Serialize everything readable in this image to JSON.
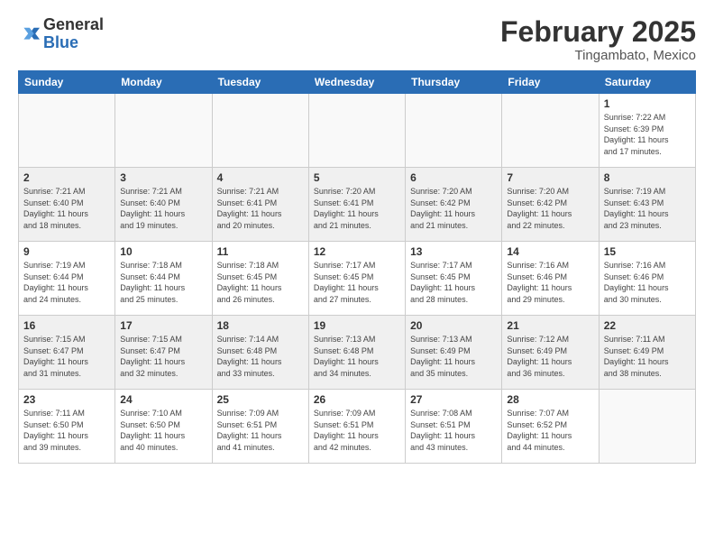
{
  "header": {
    "logo_general": "General",
    "logo_blue": "Blue",
    "month_title": "February 2025",
    "location": "Tingambato, Mexico"
  },
  "calendar": {
    "weekdays": [
      "Sunday",
      "Monday",
      "Tuesday",
      "Wednesday",
      "Thursday",
      "Friday",
      "Saturday"
    ],
    "weeks": [
      [
        {
          "day": "",
          "info": ""
        },
        {
          "day": "",
          "info": ""
        },
        {
          "day": "",
          "info": ""
        },
        {
          "day": "",
          "info": ""
        },
        {
          "day": "",
          "info": ""
        },
        {
          "day": "",
          "info": ""
        },
        {
          "day": "1",
          "info": "Sunrise: 7:22 AM\nSunset: 6:39 PM\nDaylight: 11 hours\nand 17 minutes."
        }
      ],
      [
        {
          "day": "2",
          "info": "Sunrise: 7:21 AM\nSunset: 6:40 PM\nDaylight: 11 hours\nand 18 minutes."
        },
        {
          "day": "3",
          "info": "Sunrise: 7:21 AM\nSunset: 6:40 PM\nDaylight: 11 hours\nand 19 minutes."
        },
        {
          "day": "4",
          "info": "Sunrise: 7:21 AM\nSunset: 6:41 PM\nDaylight: 11 hours\nand 20 minutes."
        },
        {
          "day": "5",
          "info": "Sunrise: 7:20 AM\nSunset: 6:41 PM\nDaylight: 11 hours\nand 21 minutes."
        },
        {
          "day": "6",
          "info": "Sunrise: 7:20 AM\nSunset: 6:42 PM\nDaylight: 11 hours\nand 21 minutes."
        },
        {
          "day": "7",
          "info": "Sunrise: 7:20 AM\nSunset: 6:42 PM\nDaylight: 11 hours\nand 22 minutes."
        },
        {
          "day": "8",
          "info": "Sunrise: 7:19 AM\nSunset: 6:43 PM\nDaylight: 11 hours\nand 23 minutes."
        }
      ],
      [
        {
          "day": "9",
          "info": "Sunrise: 7:19 AM\nSunset: 6:44 PM\nDaylight: 11 hours\nand 24 minutes."
        },
        {
          "day": "10",
          "info": "Sunrise: 7:18 AM\nSunset: 6:44 PM\nDaylight: 11 hours\nand 25 minutes."
        },
        {
          "day": "11",
          "info": "Sunrise: 7:18 AM\nSunset: 6:45 PM\nDaylight: 11 hours\nand 26 minutes."
        },
        {
          "day": "12",
          "info": "Sunrise: 7:17 AM\nSunset: 6:45 PM\nDaylight: 11 hours\nand 27 minutes."
        },
        {
          "day": "13",
          "info": "Sunrise: 7:17 AM\nSunset: 6:45 PM\nDaylight: 11 hours\nand 28 minutes."
        },
        {
          "day": "14",
          "info": "Sunrise: 7:16 AM\nSunset: 6:46 PM\nDaylight: 11 hours\nand 29 minutes."
        },
        {
          "day": "15",
          "info": "Sunrise: 7:16 AM\nSunset: 6:46 PM\nDaylight: 11 hours\nand 30 minutes."
        }
      ],
      [
        {
          "day": "16",
          "info": "Sunrise: 7:15 AM\nSunset: 6:47 PM\nDaylight: 11 hours\nand 31 minutes."
        },
        {
          "day": "17",
          "info": "Sunrise: 7:15 AM\nSunset: 6:47 PM\nDaylight: 11 hours\nand 32 minutes."
        },
        {
          "day": "18",
          "info": "Sunrise: 7:14 AM\nSunset: 6:48 PM\nDaylight: 11 hours\nand 33 minutes."
        },
        {
          "day": "19",
          "info": "Sunrise: 7:13 AM\nSunset: 6:48 PM\nDaylight: 11 hours\nand 34 minutes."
        },
        {
          "day": "20",
          "info": "Sunrise: 7:13 AM\nSunset: 6:49 PM\nDaylight: 11 hours\nand 35 minutes."
        },
        {
          "day": "21",
          "info": "Sunrise: 7:12 AM\nSunset: 6:49 PM\nDaylight: 11 hours\nand 36 minutes."
        },
        {
          "day": "22",
          "info": "Sunrise: 7:11 AM\nSunset: 6:49 PM\nDaylight: 11 hours\nand 38 minutes."
        }
      ],
      [
        {
          "day": "23",
          "info": "Sunrise: 7:11 AM\nSunset: 6:50 PM\nDaylight: 11 hours\nand 39 minutes."
        },
        {
          "day": "24",
          "info": "Sunrise: 7:10 AM\nSunset: 6:50 PM\nDaylight: 11 hours\nand 40 minutes."
        },
        {
          "day": "25",
          "info": "Sunrise: 7:09 AM\nSunset: 6:51 PM\nDaylight: 11 hours\nand 41 minutes."
        },
        {
          "day": "26",
          "info": "Sunrise: 7:09 AM\nSunset: 6:51 PM\nDaylight: 11 hours\nand 42 minutes."
        },
        {
          "day": "27",
          "info": "Sunrise: 7:08 AM\nSunset: 6:51 PM\nDaylight: 11 hours\nand 43 minutes."
        },
        {
          "day": "28",
          "info": "Sunrise: 7:07 AM\nSunset: 6:52 PM\nDaylight: 11 hours\nand 44 minutes."
        },
        {
          "day": "",
          "info": ""
        }
      ]
    ]
  }
}
